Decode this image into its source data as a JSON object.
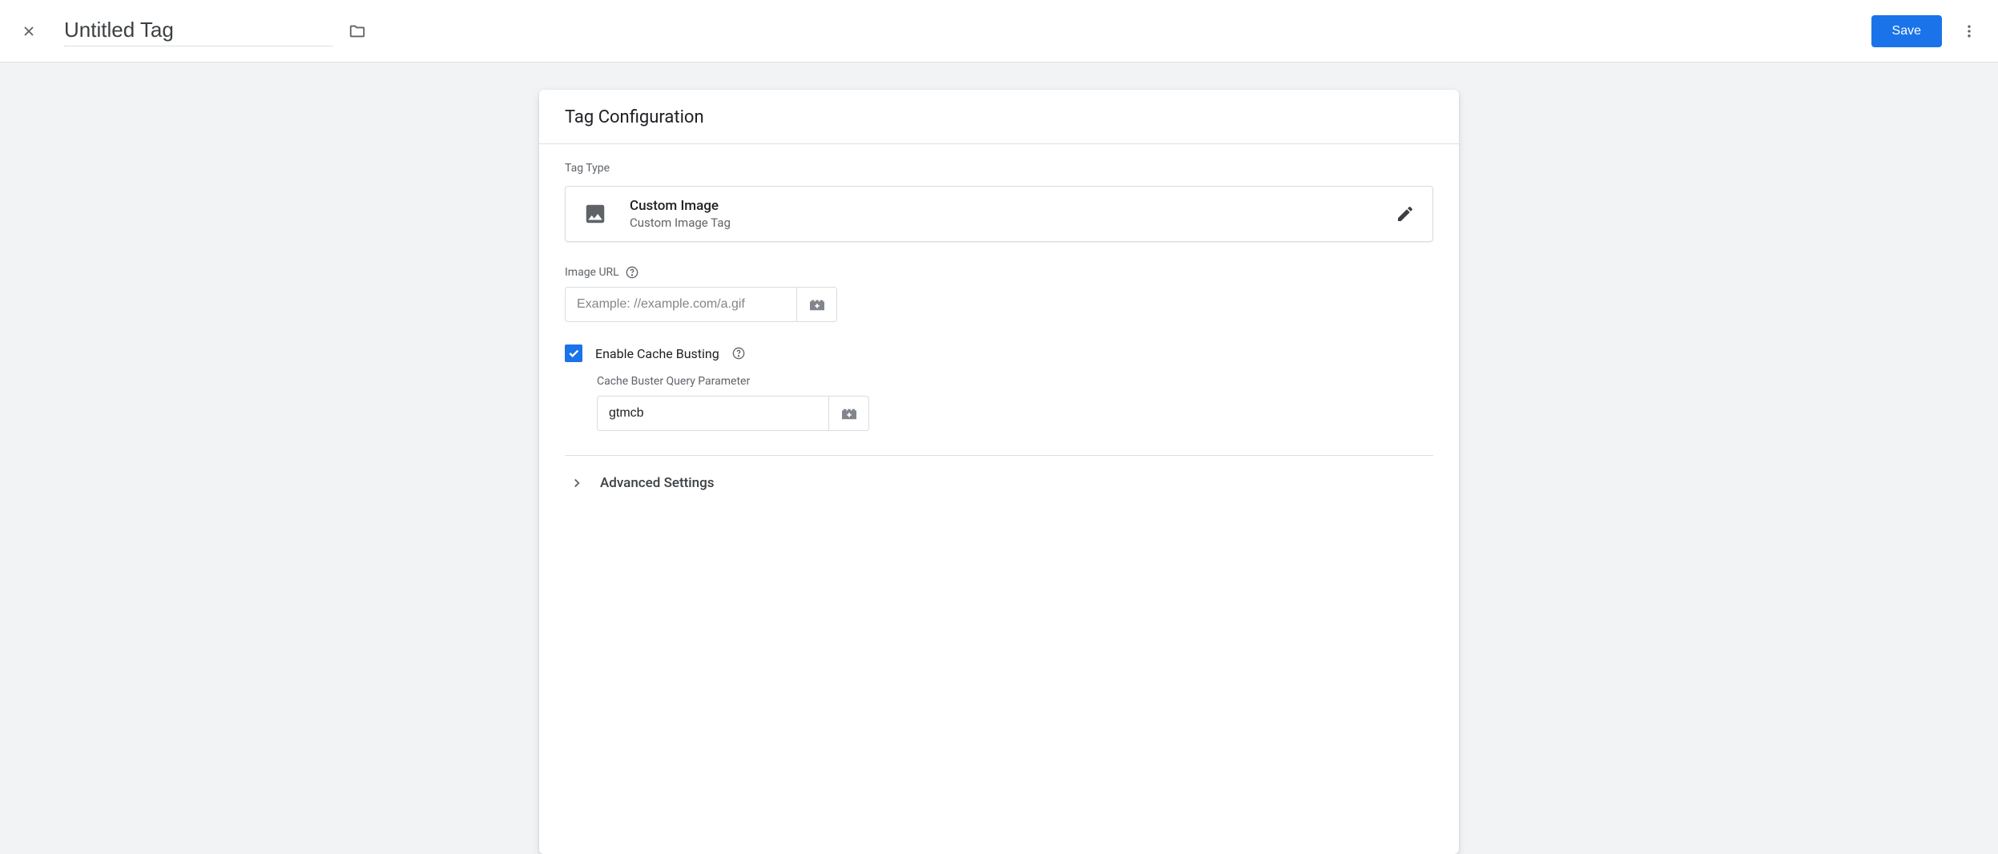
{
  "header": {
    "title": "Untitled Tag",
    "save_label": "Save"
  },
  "card": {
    "title": "Tag Configuration",
    "tag_type_label": "Tag Type",
    "tag_type": {
      "name": "Custom Image",
      "desc": "Custom Image Tag"
    },
    "image_url": {
      "label": "Image URL",
      "placeholder": "Example: //example.com/a.gif",
      "value": ""
    },
    "cache_busting": {
      "label": "Enable Cache Busting",
      "checked": true,
      "param_label": "Cache Buster Query Parameter",
      "param_value": "gtmcb"
    },
    "advanced_label": "Advanced Settings"
  }
}
